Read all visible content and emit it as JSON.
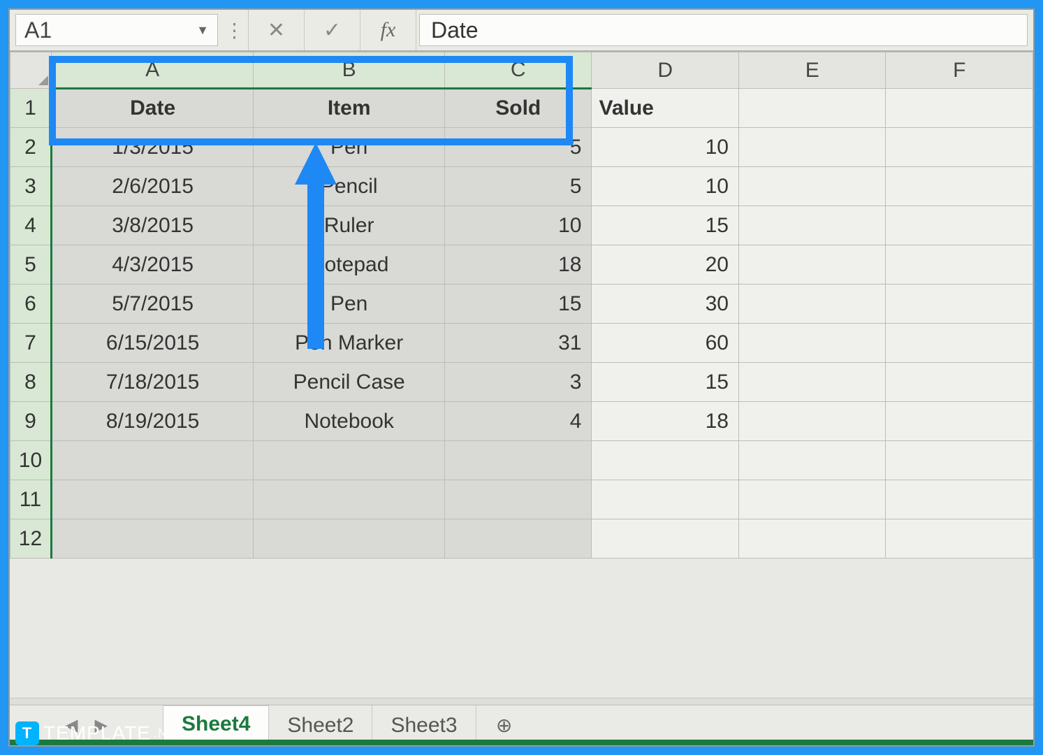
{
  "formula_bar": {
    "name_box": "A1",
    "content": "Date"
  },
  "columns": [
    "A",
    "B",
    "C",
    "D",
    "E",
    "F"
  ],
  "selected_columns": [
    "A",
    "B",
    "C"
  ],
  "headers": {
    "A": "Date",
    "B": "Item",
    "C": "Sold",
    "D": "Value"
  },
  "rows": [
    {
      "n": 1
    },
    {
      "n": 2,
      "A": "1/3/2015",
      "B": "Pen",
      "C": "5",
      "D": "10"
    },
    {
      "n": 3,
      "A": "2/6/2015",
      "B": "Pencil",
      "C": "5",
      "D": "10"
    },
    {
      "n": 4,
      "A": "3/8/2015",
      "B": "Ruler",
      "C": "10",
      "D": "15"
    },
    {
      "n": 5,
      "A": "4/3/2015",
      "B": "Notepad",
      "C": "18",
      "D": "20"
    },
    {
      "n": 6,
      "A": "5/7/2015",
      "B": "Pen",
      "C": "15",
      "D": "30"
    },
    {
      "n": 7,
      "A": "6/15/2015",
      "B": "Pen Marker",
      "C": "31",
      "D": "60"
    },
    {
      "n": 8,
      "A": "7/18/2015",
      "B": "Pencil Case",
      "C": "3",
      "D": "15"
    },
    {
      "n": 9,
      "A": "8/19/2015",
      "B": "Notebook",
      "C": "4",
      "D": "18"
    },
    {
      "n": 10
    },
    {
      "n": 11
    },
    {
      "n": 12
    }
  ],
  "col_widths": {
    "row": 56,
    "A": 275,
    "B": 260,
    "C": 200,
    "D": 200,
    "E": 200,
    "F": 200
  },
  "sheet_tabs": [
    {
      "label": "Sheet4",
      "active": true
    },
    {
      "label": "Sheet2",
      "active": false
    },
    {
      "label": "Sheet3",
      "active": false
    }
  ],
  "watermark": {
    "badge": "T",
    "text": "TEMPLATE",
    "suffix": ".NET"
  },
  "icons": {
    "dropdown": "▼",
    "more": "⋮",
    "cancel": "✕",
    "confirm": "✓",
    "fx": "fx",
    "nav_first": "◀",
    "nav_last": "▶",
    "add": "⊕"
  }
}
